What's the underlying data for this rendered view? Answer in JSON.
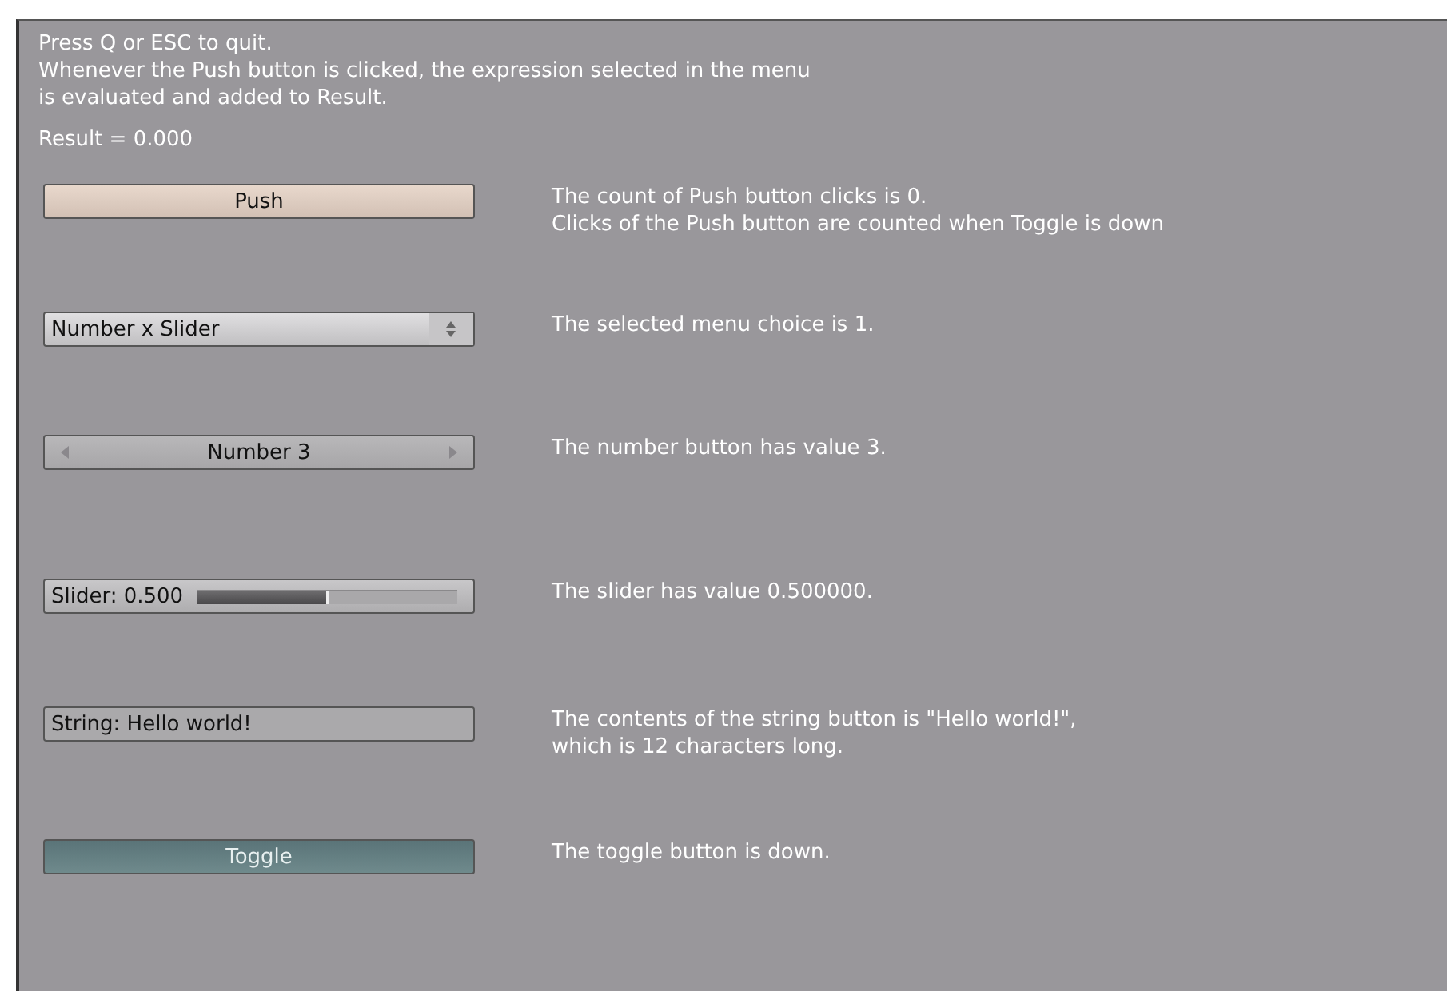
{
  "intro": [
    "Press Q or ESC to quit.",
    "Whenever the Push button is clicked, the expression selected in the menu",
    "is evaluated and added to Result."
  ],
  "result": "Result = 0.000",
  "rows": [
    {
      "kind": "push",
      "label": "Push",
      "description": [
        "The count of Push button clicks is 0.",
        "Clicks of the Push button are counted when Toggle is down"
      ]
    },
    {
      "kind": "menu",
      "label": "Number x Slider",
      "description": [
        "The selected menu choice is 1."
      ]
    },
    {
      "kind": "number",
      "label": "Number 3",
      "description": [
        "The number button has value 3."
      ]
    },
    {
      "kind": "slider",
      "label": "Slider: 0.500",
      "level": 0.5,
      "description": [
        "The slider has value 0.500000."
      ]
    },
    {
      "kind": "string",
      "label": "String: Hello world!",
      "description": [
        "The contents of the string button is \"Hello world!\",",
        "which is 12 characters long."
      ]
    },
    {
      "kind": "toggle",
      "label": "Toggle",
      "on": true,
      "description": [
        "The toggle button is down."
      ]
    }
  ]
}
